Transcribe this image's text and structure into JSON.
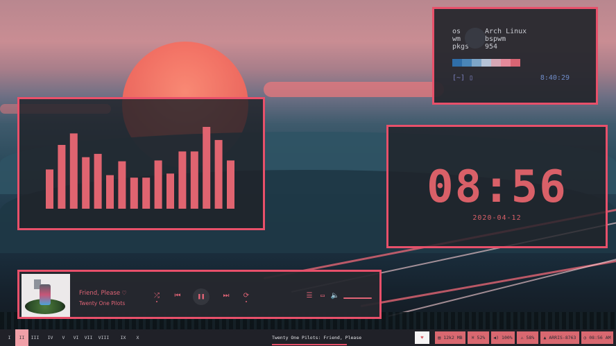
{
  "sysinfo": {
    "rows": [
      {
        "key": "os",
        "value": "Arch Linux"
      },
      {
        "key": "wm",
        "value": "bspwm"
      },
      {
        "key": "pkgs",
        "value": "954"
      }
    ],
    "palette": [
      "#2f6ea8",
      "#4a86b8",
      "#7ea6c8",
      "#b6c4d8",
      "#d7a8b6",
      "#e58a9b",
      "#d96574"
    ],
    "prompt": "[~] ▯",
    "time": "8:40:29"
  },
  "visualizer": {
    "bar_color": "#e06470",
    "levels": [
      0.48,
      0.78,
      0.92,
      0.63,
      0.67,
      0.41,
      0.58,
      0.38,
      0.38,
      0.59,
      0.43,
      0.7,
      0.7,
      1.0,
      0.84,
      0.59
    ]
  },
  "clock": {
    "time": "08:56",
    "date": "2020-04-12"
  },
  "music": {
    "title": "Friend, Please",
    "artist": "Twenty One Pilots",
    "heart": "♡",
    "shuffle": "⤮",
    "prev": "⏮",
    "pause": "❚❚",
    "next": "⏭",
    "repeat": "⟳",
    "queue": "☰",
    "devices": "▭",
    "volume": "🔈",
    "volume_level": 0.95
  },
  "bar": {
    "workspaces": [
      "I",
      "II",
      "III",
      "IV",
      "V",
      "VI",
      "VII",
      "VIII",
      "IX",
      "X"
    ],
    "active_workspace": 1,
    "window_title": "Twenty One Pilots: Friend, Please",
    "modules": [
      {
        "label": "♥"
      },
      {
        "label": "▤ 12k2 MB"
      },
      {
        "label": "⌘ 52%"
      },
      {
        "label": "◀) 100%"
      },
      {
        "label": "⚠ 58%"
      },
      {
        "label": "▲ ARRIS-8763"
      },
      {
        "label": "◷ 08:56 AM"
      }
    ]
  }
}
